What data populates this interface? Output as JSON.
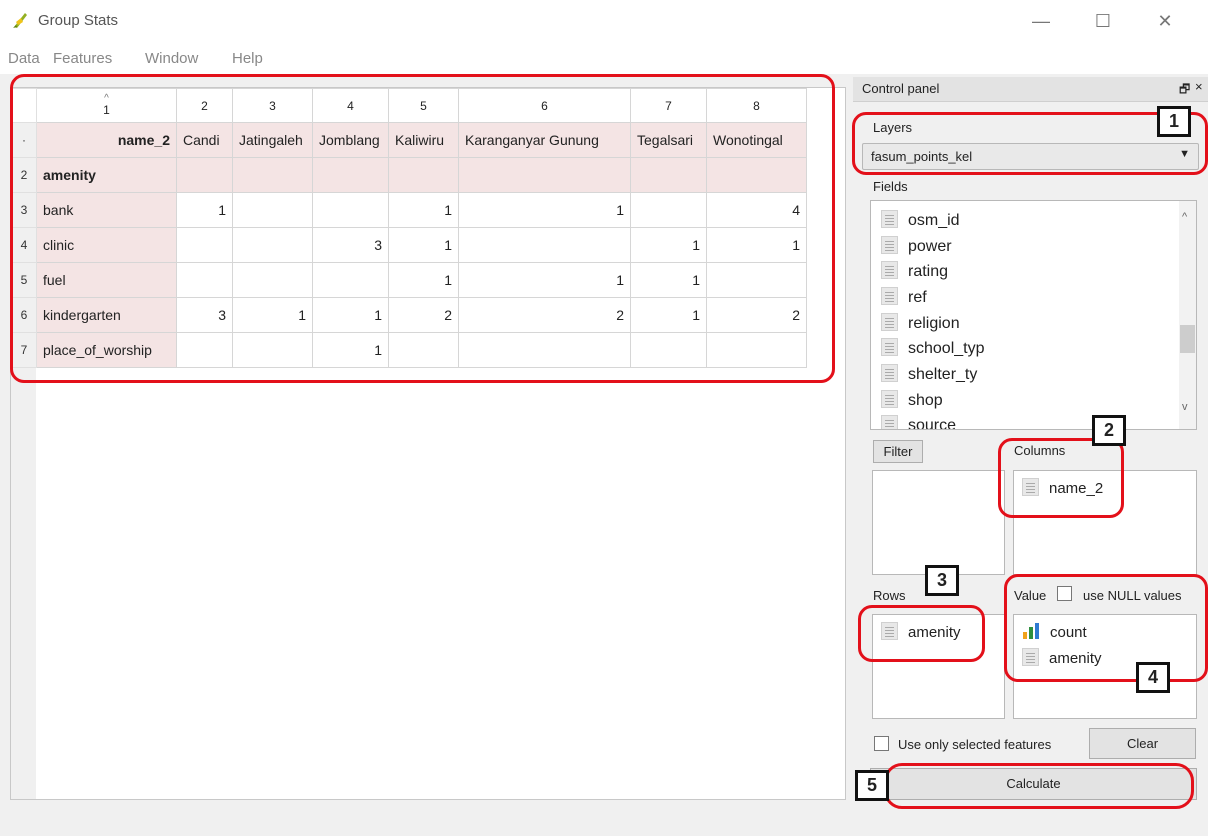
{
  "window": {
    "title": "Group Stats",
    "minimize": "—",
    "maximize": "☐",
    "close": "✕"
  },
  "menu": [
    "Data",
    "Features",
    "Window",
    "Help"
  ],
  "table": {
    "sort_arrow": "^",
    "column_numbers": [
      "1",
      "2",
      "3",
      "4",
      "5",
      "6",
      "7",
      "8"
    ],
    "header_marker": "·",
    "header_label": "name_2",
    "columns": [
      "Candi",
      "Jatingaleh",
      "Jomblang",
      "Kaliwiru",
      "Karanganyar Gunung",
      "Tegalsari",
      "Wonotingal"
    ],
    "row_group": {
      "number": "2",
      "label": "amenity"
    },
    "rows": [
      {
        "n": "3",
        "label": "bank",
        "values": [
          "1",
          "",
          "",
          "1",
          "1",
          "",
          "4"
        ]
      },
      {
        "n": "4",
        "label": "clinic",
        "values": [
          "",
          "",
          "3",
          "1",
          "",
          "1",
          "1"
        ]
      },
      {
        "n": "5",
        "label": "fuel",
        "values": [
          "",
          "",
          "",
          "1",
          "1",
          "1",
          ""
        ]
      },
      {
        "n": "6",
        "label": "kindergarten",
        "values": [
          "3",
          "1",
          "1",
          "2",
          "2",
          "1",
          "2"
        ]
      },
      {
        "n": "7",
        "label": "place_of_worship",
        "values": [
          "",
          "",
          "1",
          "",
          "",
          "",
          ""
        ]
      }
    ]
  },
  "control_panel": {
    "title": "Control panel",
    "float_icon": "🗗",
    "close_icon": "×",
    "layers_label": "Layers",
    "layers_value": "fasum_points_kel",
    "dropdown_arrow": "▼",
    "fields_label": "Fields",
    "fields": [
      "osm_id",
      "power",
      "rating",
      "ref",
      "religion",
      "school_typ",
      "shelter_ty",
      "shop",
      "source"
    ],
    "scroll_up": "^",
    "scroll_down": "v",
    "filter_button": "Filter",
    "columns_label": "Columns",
    "columns_items": [
      "name_2"
    ],
    "rows_label": "Rows",
    "rows_items": [
      "amenity"
    ],
    "value_label": "Value",
    "use_null_label": "use NULL values",
    "value_items": [
      "count",
      "amenity"
    ],
    "use_selected_label": "Use only selected features",
    "clear_button": "Clear",
    "calculate_button": "Calculate"
  },
  "annotations": [
    "1",
    "2",
    "3",
    "4",
    "5"
  ],
  "colors": {
    "annotation": "#e3101a",
    "header_pink": "#f4e4e4",
    "chart_bar": "#2f8f3f"
  }
}
